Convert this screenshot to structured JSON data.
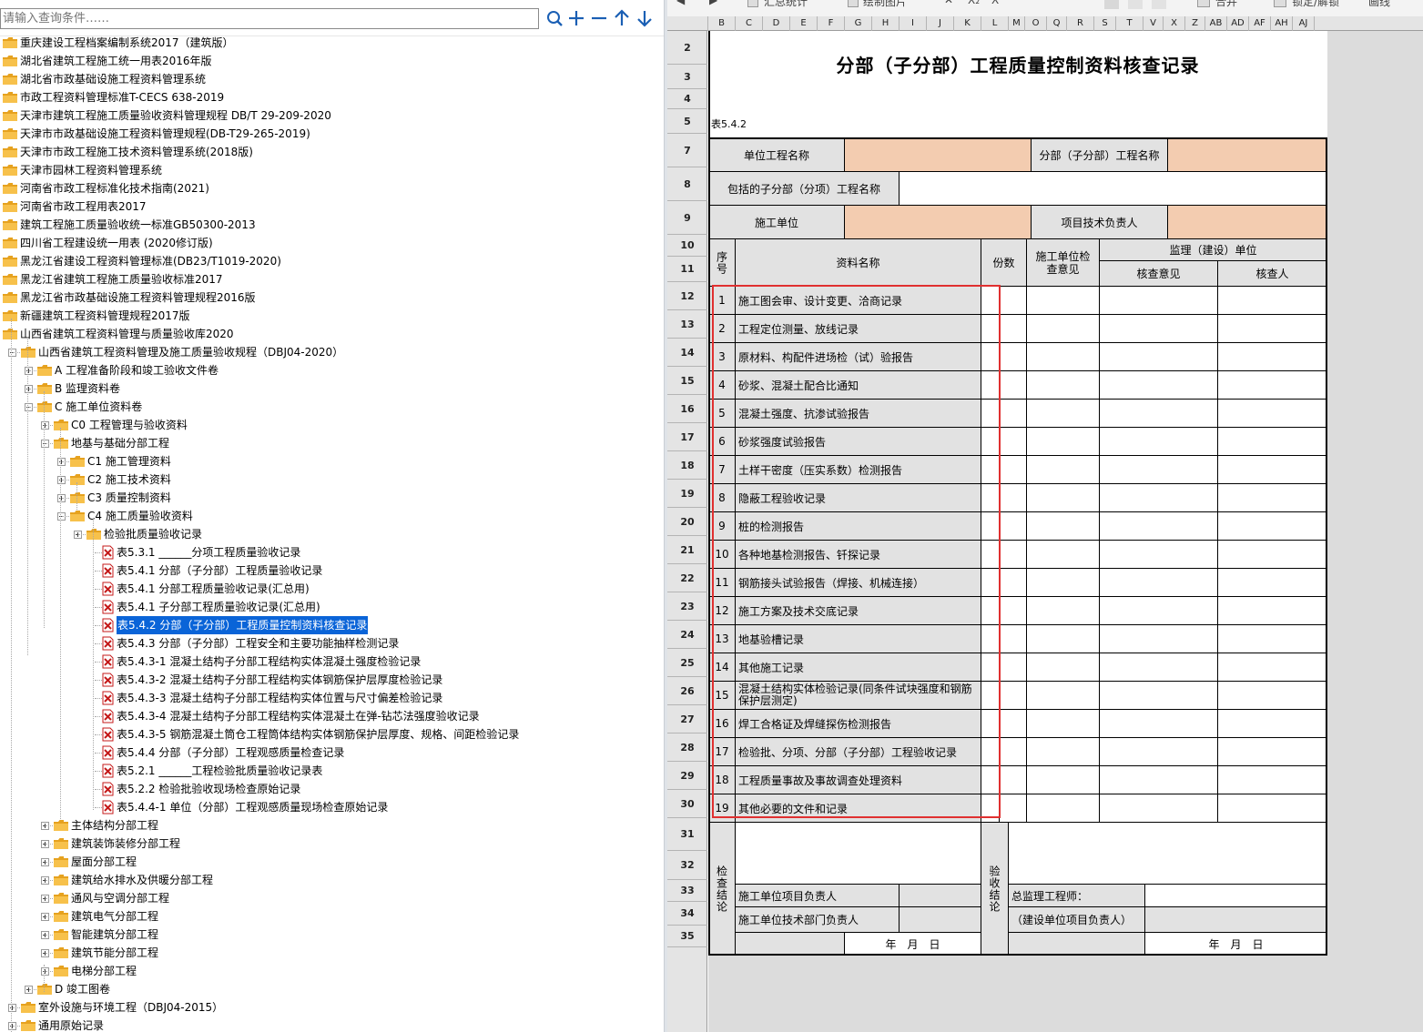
{
  "search": {
    "placeholder": "请输入查询条件……"
  },
  "search_actions": [
    "search-icon",
    "plus-icon",
    "minus-icon",
    "up-arrow-icon",
    "down-arrow-icon"
  ],
  "tree_items": [
    {
      "label": "重庆建设工程档案编制系统2017（建筑版）",
      "type": "folder"
    },
    {
      "label": "湖北省建筑工程施工统一用表2016年版",
      "type": "folder"
    },
    {
      "label": "湖北省市政基础设施工程资料管理系统",
      "type": "folder"
    },
    {
      "label": "市政工程资料管理标准T-CECS 638-2019",
      "type": "folder"
    },
    {
      "label": "天津市建筑工程施工质量验收资料管理规程 DB/T 29-209-2020",
      "type": "folder"
    },
    {
      "label": "天津市市政基础设施工程资料管理规程(DB-T29-265-2019)",
      "type": "folder"
    },
    {
      "label": "天津市市政工程施工技术资料管理系统(2018版)",
      "type": "folder"
    },
    {
      "label": "天津市园林工程资料管理系统",
      "type": "folder"
    },
    {
      "label": "河南省市政工程标准化技术指南(2021)",
      "type": "folder"
    },
    {
      "label": "河南省市政工程用表2017",
      "type": "folder"
    },
    {
      "label": "建筑工程施工质量验收统一标准GB50300-2013",
      "type": "folder"
    },
    {
      "label": "四川省工程建设统一用表 (2020修订版)",
      "type": "folder"
    },
    {
      "label": "黑龙江省建设工程资料管理标准(DB23/T1019-2020)",
      "type": "folder"
    },
    {
      "label": "黑龙江省建筑工程施工质量验收标准2017",
      "type": "folder"
    },
    {
      "label": "黑龙江省市政基础设施工程资料管理规程2016版",
      "type": "folder"
    },
    {
      "label": "新疆建筑工程资料管理规程2017版",
      "type": "folder"
    },
    {
      "label": "山西省建筑工程资料管理与质量验收库2020",
      "type": "folder",
      "expanded": true
    },
    {
      "label": "山西省建筑工程资料管理及施工质量验收规程（DBJ04-2020）",
      "type": "folder",
      "expanded": true
    },
    {
      "label": "A 工程准备阶段和竣工验收文件卷",
      "type": "folder"
    },
    {
      "label": "B 监理资料卷",
      "type": "folder"
    },
    {
      "label": "C 施工单位资料卷",
      "type": "folder",
      "expanded": true
    },
    {
      "label": "C0 工程管理与验收资料",
      "type": "folder"
    },
    {
      "label": "地基与基础分部工程",
      "type": "folder",
      "expanded": true
    },
    {
      "label": "C1 施工管理资料",
      "type": "folder"
    },
    {
      "label": "C2 施工技术资料",
      "type": "folder"
    },
    {
      "label": "C3 质量控制资料",
      "type": "folder"
    },
    {
      "label": "C4 施工质量验收资料",
      "type": "folder",
      "expanded": true
    },
    {
      "label": "检验批质量验收记录",
      "type": "folder"
    },
    {
      "label": "表5.3.1 ______分项工程质量验收记录",
      "type": "doc"
    },
    {
      "label": "表5.4.1 分部（子分部）工程质量验收记录",
      "type": "doc"
    },
    {
      "label": "表5.4.1 分部工程质量验收记录(汇总用)",
      "type": "doc"
    },
    {
      "label": "表5.4.1 子分部工程质量验收记录(汇总用)",
      "type": "doc"
    },
    {
      "label": "表5.4.2 分部（子分部）工程质量控制资料核查记录",
      "type": "doc",
      "selected": true
    },
    {
      "label": "表5.4.3 分部（子分部）工程安全和主要功能抽样检测记录",
      "type": "doc"
    },
    {
      "label": "表5.4.3-1 混凝土结构子分部工程结构实体混凝土强度检验记录",
      "type": "doc"
    },
    {
      "label": "表5.4.3-2 混凝土结构子分部工程结构实体钢筋保护层厚度检验记录",
      "type": "doc"
    },
    {
      "label": "表5.4.3-3 混凝土结构子分部工程结构实体位置与尺寸偏差检验记录",
      "type": "doc"
    },
    {
      "label": "表5.4.3-4 混凝土结构子分部工程结构实体混凝土在弹-钻芯法强度验收记录",
      "type": "doc"
    },
    {
      "label": "表5.4.3-5 钢筋混凝土筒仓工程筒体结构实体钢筋保护层厚度、规格、间距检验记录",
      "type": "doc"
    },
    {
      "label": "表5.4.4 分部（子分部）工程观感质量检查记录",
      "type": "doc"
    },
    {
      "label": "表5.2.1 ______工程检验批质量验收记录表",
      "type": "doc"
    },
    {
      "label": "表5.2.2 检验批验收现场检查原始记录",
      "type": "doc"
    },
    {
      "label": "表5.4.4-1 单位（分部）工程观感质量现场检查原始记录",
      "type": "doc"
    },
    {
      "label": "主体结构分部工程",
      "type": "folder"
    },
    {
      "label": "建筑装饰装修分部工程",
      "type": "folder"
    },
    {
      "label": "屋面分部工程",
      "type": "folder"
    },
    {
      "label": "建筑给水排水及供暖分部工程",
      "type": "folder"
    },
    {
      "label": "通风与空调分部工程",
      "type": "folder"
    },
    {
      "label": "建筑电气分部工程",
      "type": "folder"
    },
    {
      "label": "智能建筑分部工程",
      "type": "folder"
    },
    {
      "label": "建筑节能分部工程",
      "type": "folder"
    },
    {
      "label": "电梯分部工程",
      "type": "folder"
    },
    {
      "label": "D 竣工图卷",
      "type": "folder"
    },
    {
      "label": "室外设施与环境工程（DBJ04-2015）",
      "type": "folder"
    },
    {
      "label": "通用原始记录",
      "type": "folder"
    }
  ],
  "toolbar": {
    "items": [
      "汇总统计",
      "绘制图片",
      "合并",
      "锁定/解锁",
      "画线"
    ],
    "icons": [
      "undo-icon",
      "redo-icon",
      "summary-icon",
      "image-icon",
      "clear-format-icon",
      "subscript-icon",
      "superscript-icon",
      "align-left-icon",
      "align-center-icon",
      "align-right-icon",
      "merge-icon",
      "lock-icon"
    ]
  },
  "column_headers": [
    "B",
    "C",
    "D",
    "E",
    "F",
    "G",
    "H",
    "I",
    "J",
    "K",
    "L",
    "M",
    "O",
    "Q",
    "R",
    "S",
    "T",
    "V",
    "X",
    "Z",
    "AB",
    "AD",
    "AF",
    "AH",
    "AJ"
  ],
  "row_headers": [
    "2",
    "3",
    "4",
    "5",
    "7",
    "8",
    "9",
    "10",
    "11",
    "12",
    "13",
    "14",
    "15",
    "16",
    "17",
    "18",
    "19",
    "20",
    "21",
    "22",
    "23",
    "24",
    "25",
    "26",
    "27",
    "28",
    "29",
    "30",
    "31",
    "32",
    "33",
    "34",
    "35"
  ],
  "form": {
    "title": "分部（子分部）工程质量控制资料核查记录",
    "table_no": "表5.4.2",
    "unit_project_name": "单位工程名称",
    "sub_project_name": "分部（子分部）工程名称",
    "included_items": "包括的子分部（分项）工程名称",
    "construction_unit": "施工单位",
    "tech_lead": "项目技术负责人",
    "col_seq": "序号",
    "col_name": "资料名称",
    "col_copies": "份数",
    "col_contractor_review": "施工单位检查意见",
    "col_supervision": "监理（建设）单位",
    "col_review_opinion": "核查意见",
    "col_reviewer": "核查人",
    "items": [
      {
        "no": "1",
        "name": "施工图会审、设计变更、洽商记录"
      },
      {
        "no": "2",
        "name": "工程定位测量、放线记录"
      },
      {
        "no": "3",
        "name": "原材料、构配件进场检（试）验报告"
      },
      {
        "no": "4",
        "name": "砂浆、混凝土配合比通知"
      },
      {
        "no": "5",
        "name": "混凝土强度、抗渗试验报告"
      },
      {
        "no": "6",
        "name": "砂浆强度试验报告"
      },
      {
        "no": "7",
        "name": "土样干密度（压实系数）检测报告"
      },
      {
        "no": "8",
        "name": "隐蔽工程验收记录"
      },
      {
        "no": "9",
        "name": "桩的检测报告"
      },
      {
        "no": "10",
        "name": "各种地基检测报告、钎探记录"
      },
      {
        "no": "11",
        "name": "钢筋接头试验报告（焊接、机械连接）"
      },
      {
        "no": "12",
        "name": "施工方案及技术交底记录"
      },
      {
        "no": "13",
        "name": "地基验槽记录"
      },
      {
        "no": "14",
        "name": "其他施工记录"
      },
      {
        "no": "15",
        "name": "混凝土结构实体检验记录(同条件试块强度和钢筋保护层测定)"
      },
      {
        "no": "16",
        "name": "焊工合格证及焊缝探伤检测报告"
      },
      {
        "no": "17",
        "name": "检验批、分项、分部（子分部）工程验收记录"
      },
      {
        "no": "18",
        "name": "工程质量事故及事故调查处理资料"
      },
      {
        "no": "19",
        "name": "其他必要的文件和记录"
      }
    ],
    "check_conclusion": "检查结论",
    "acceptance_conclusion": "验收结论",
    "contractor_pm": "施工单位项目负责人",
    "contractor_tech_dept": "施工单位技术部门负责人",
    "chief_supervisor": "总监理工程师：",
    "owner_pm": "（建设单位项目负责人）",
    "date_left": "年　月　日",
    "date_right": "年　月　日"
  },
  "colors": {
    "highlight_box": "#e03030",
    "input_cell": "#f3ccb0",
    "label_cell": "#e2e2e2",
    "selection": "#0a64d8"
  }
}
